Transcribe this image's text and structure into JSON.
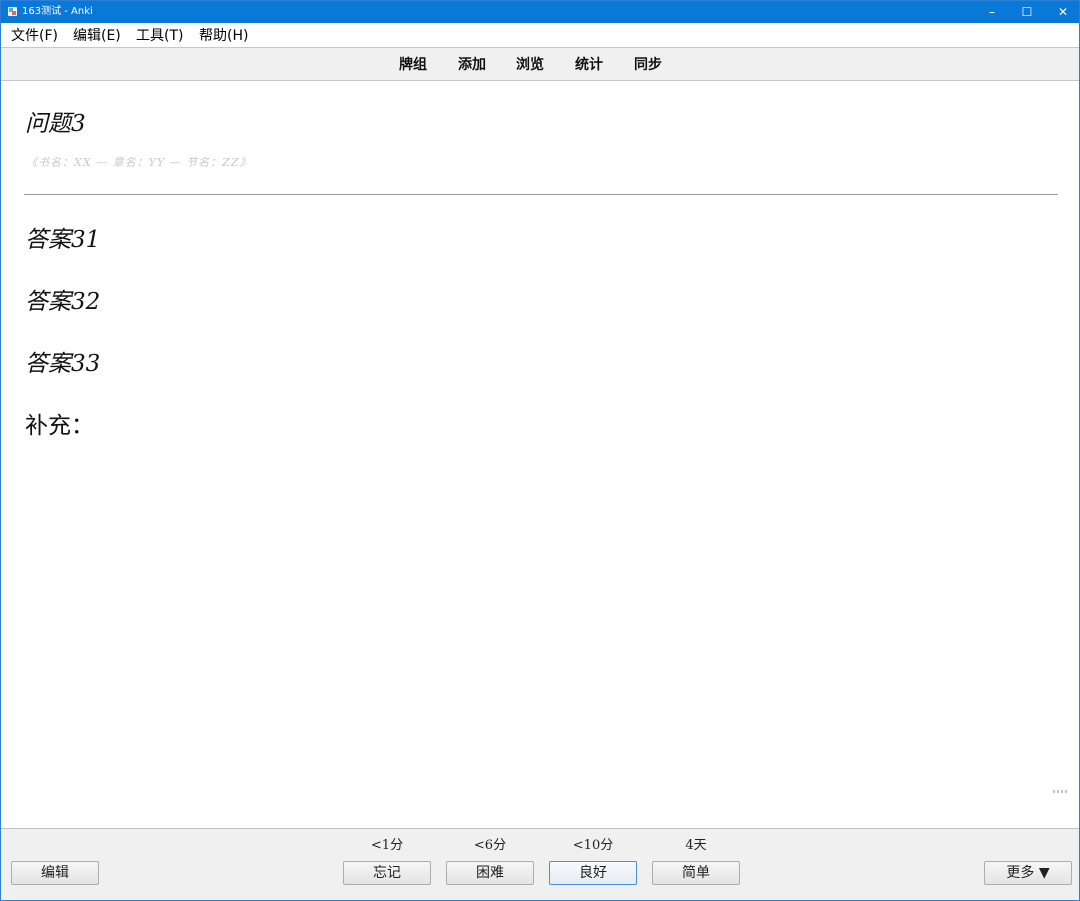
{
  "window": {
    "title": "163测试 - Anki",
    "controls": {
      "minimize": "–",
      "maximize": "☐",
      "close": "✕"
    }
  },
  "menubar": {
    "items": [
      {
        "label": "文件(F)"
      },
      {
        "label": "编辑(E)"
      },
      {
        "label": "工具(T)"
      },
      {
        "label": "帮助(H)"
      }
    ]
  },
  "toolbar": {
    "links": [
      {
        "label": "牌组"
      },
      {
        "label": "添加"
      },
      {
        "label": "浏览"
      },
      {
        "label": "统计"
      },
      {
        "label": "同步"
      }
    ]
  },
  "card": {
    "question": "问题3",
    "meta": "《书名：XX — 章名：YY — 节名：ZZ》",
    "answers": [
      "答案31",
      "答案32",
      "答案33"
    ],
    "supplement": "补充："
  },
  "bottombar": {
    "edit_label": "编辑",
    "more_label": "更多 ▼",
    "answer_buttons": [
      {
        "interval": "<1分",
        "label": "忘记"
      },
      {
        "interval": "<6分",
        "label": "困难"
      },
      {
        "interval": "<10分",
        "label": "良好"
      },
      {
        "interval": "4天",
        "label": "简单"
      }
    ]
  },
  "colors": {
    "titlebar": "#0a78d7",
    "toolbar_bg": "#f0f0f0",
    "meta_text": "#c8c8c8",
    "focus_border": "#4a8fd8"
  }
}
